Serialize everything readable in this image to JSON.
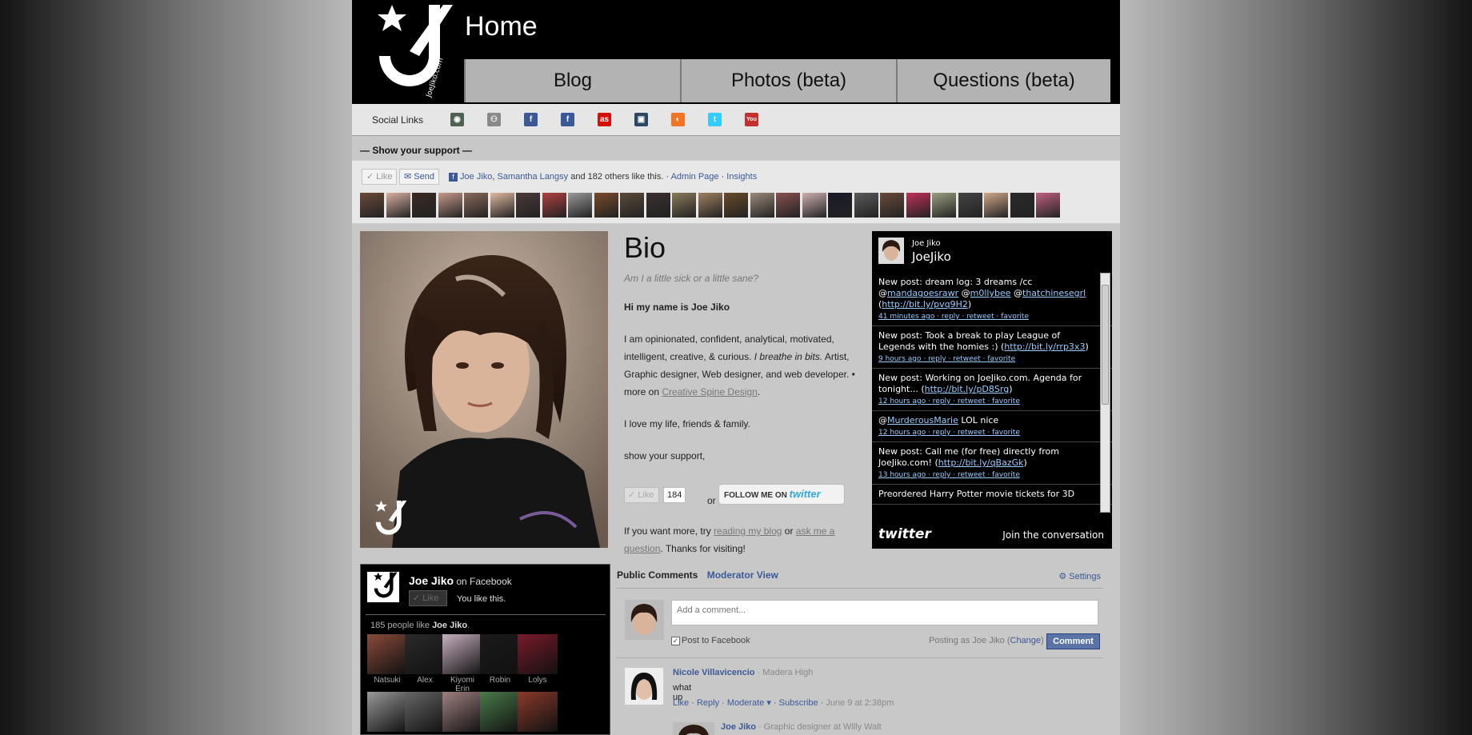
{
  "header": {
    "title": "Home",
    "logo_text": "JoeJiko.com"
  },
  "nav": {
    "tabs": [
      {
        "label": "Blog"
      },
      {
        "label": "Photos (beta)"
      },
      {
        "label": "Questions (beta)"
      }
    ]
  },
  "social": {
    "label": "Social Links",
    "icons": [
      {
        "name": "deviantart-icon",
        "glyph": "◉",
        "color": "#4e6252"
      },
      {
        "name": "myspace-icon",
        "glyph": "⚇",
        "color": "#8a8a8a"
      },
      {
        "name": "facebook-icon",
        "glyph": "f",
        "color": "#3b5998"
      },
      {
        "name": "facebook-page-icon",
        "glyph": "f",
        "color": "#3b5998"
      },
      {
        "name": "lastfm-icon",
        "glyph": "as",
        "color": "#d51007"
      },
      {
        "name": "tumblr-icon",
        "glyph": "▣",
        "color": "#2c4762"
      },
      {
        "name": "crunchyroll-icon",
        "glyph": "◐",
        "color": "#f47521"
      },
      {
        "name": "twitter-icon",
        "glyph": "t",
        "color": "#33ccff"
      },
      {
        "name": "youtube-icon",
        "glyph": "You",
        "color": "#c4302b"
      }
    ]
  },
  "support": {
    "title": "— Show your support —",
    "like_label": "✓ Like",
    "send_label": "Send",
    "friend1": "Joe Jiko",
    "sep": ", ",
    "friend2": "Samantha Langsy",
    "others": " and 182 others like this.",
    "dot1": " · ",
    "admin": "Admin Page",
    "dot2": " · ",
    "insights": "Insights"
  },
  "bio": {
    "heading": "Bio",
    "tagline": "Am I a little sick or a little sane?",
    "greeting": "Hi my name is Joe Jiko",
    "para1_a": "I am opinionated, confident, analytical, motivated, intelligent, creative, & curious. ",
    "para1_italic": "I breathe in bits.",
    "para1_b": " Artist, Graphic designer, Web designer, and web developer. • more on ",
    "para1_link": "Creative Spine Design",
    "para1_end": ".",
    "para2": "I love my life, friends & family.",
    "para3": "show your support,",
    "like_label": "✓ Like",
    "like_count": "184",
    "or": "or",
    "follow_a": "FOLLOW ME ON ",
    "follow_b": "twitter",
    "closing_a": "If you want more, try ",
    "closing_link1": "reading my blog",
    "closing_or": " or ",
    "closing_link2": "ask me a question",
    "closing_end": ". Thanks for visiting!"
  },
  "twitter": {
    "name": "Joe Jiko",
    "handle": "JoeJiko",
    "footer_logo": "twitter",
    "join": "Join the conversation",
    "tweets": [
      {
        "pre": "New post: dream log: 3 dreams /cc @",
        "u1": "mandagoesrawr",
        "mid1": " @",
        "u2": "m0llybee",
        "mid2": " @",
        "u3": "thatchinesegrl",
        "mid3": " (",
        "u4": "http://bit.ly/pvq9H2",
        "post": ")",
        "meta": "41 minutes ago · reply · retweet · favorite"
      },
      {
        "pre": "New post: Took a break to play League of Legends with the homies :) (",
        "u1": "http://bit.ly/rrp3x3",
        "mid1": ")",
        "u2": "",
        "mid2": "",
        "u3": "",
        "mid3": "",
        "u4": "",
        "post": "",
        "meta": "9 hours ago · reply · retweet · favorite"
      },
      {
        "pre": "New post: Working on JoeJiko.com. Agenda for tonight... (",
        "u1": "http://bit.ly/pD8Srg",
        "mid1": ")",
        "u2": "",
        "mid2": "",
        "u3": "",
        "mid3": "",
        "u4": "",
        "post": "",
        "meta": "12 hours ago · reply · retweet · favorite"
      },
      {
        "pre": "@",
        "u1": "MurderousMarie",
        "mid1": " LOL nice",
        "u2": "",
        "mid2": "",
        "u3": "",
        "mid3": "",
        "u4": "",
        "post": "",
        "meta": "12 hours ago · reply · retweet · favorite"
      },
      {
        "pre": "New post: Call me (for free) directly from JoeJiko.com! (",
        "u1": "http://bit.ly/qBazGk",
        "mid1": ")",
        "u2": "",
        "mid2": "",
        "u3": "",
        "mid3": "",
        "u4": "",
        "post": "",
        "meta": "13 hours ago · reply · retweet · favorite"
      },
      {
        "pre": "Preordered Harry Potter movie tickets for 3D",
        "u1": "",
        "mid1": "",
        "u2": "",
        "mid2": "",
        "u3": "",
        "mid3": "",
        "u4": "",
        "post": "",
        "meta": ""
      }
    ]
  },
  "fanbox": {
    "name": "Joe Jiko",
    "on_fb": " on Facebook",
    "like_label": "✓ Like",
    "you_like": "You like this.",
    "count_pre": "185 people like ",
    "count_name": "Joe Jiko",
    "count_end": ".",
    "friends": [
      "Natsuki",
      "Alex",
      "Kiyomi Erin",
      "Robin",
      "Lolys",
      "",
      "",
      "",
      "",
      ""
    ]
  },
  "comments": {
    "tab_public": "Public Comments",
    "tab_moderator": "Moderator View",
    "settings": "Settings",
    "placeholder": "Add a comment...",
    "post_to_fb": "Post to Facebook",
    "posting_as": "Posting as Joe Jiko (",
    "change": "Change",
    "posting_end": ")",
    "submit": "Comment",
    "items": [
      {
        "author": "Nicole Villavicencio",
        "aff": " · Madera High",
        "text": "what up",
        "actions": "Like · Reply · Moderate ▾ · Subscribe · ",
        "ts": "June 9 at 2:38pm"
      },
      {
        "author": "Joe Jiko",
        "aff": " · Graphic designer at Willy Walt",
        "text": "",
        "actions": "",
        "ts": ""
      }
    ]
  }
}
